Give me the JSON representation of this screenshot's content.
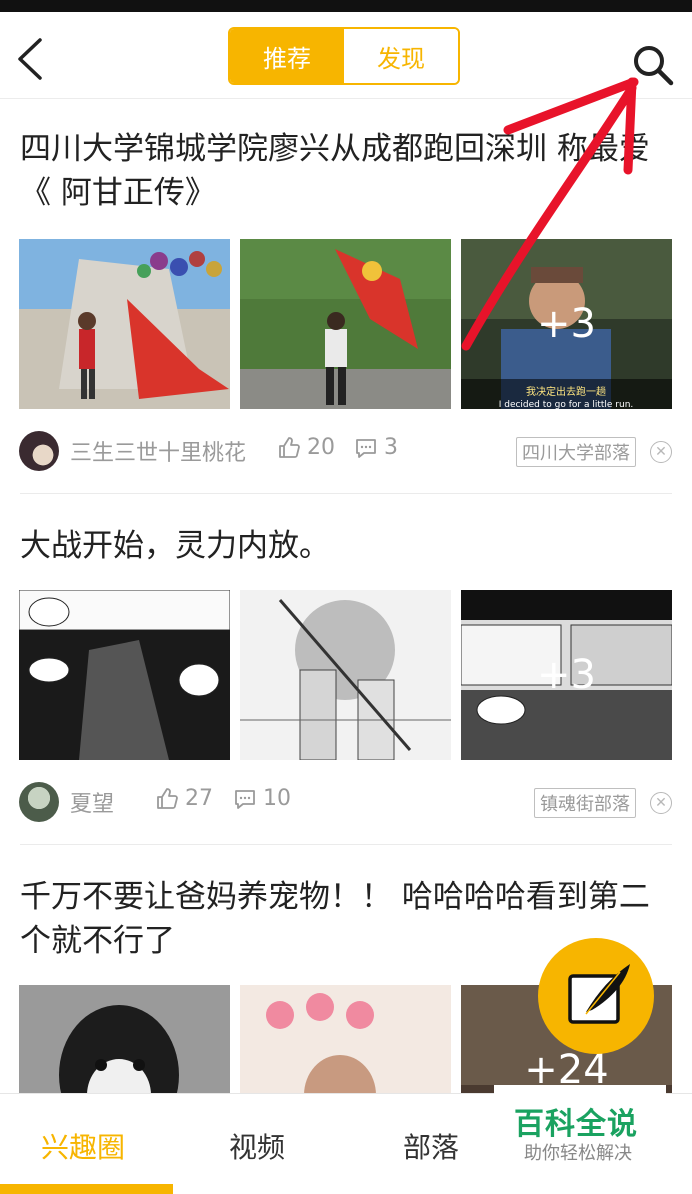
{
  "header": {
    "tabs": [
      {
        "label": "推荐",
        "active": true
      },
      {
        "label": "发现",
        "active": false
      }
    ]
  },
  "posts": [
    {
      "title": "四川大学锦城学院廖兴从成都跑回深圳 称最爱《 阿甘正传》",
      "more_count": "+3",
      "user": "三生三世十里桃花",
      "likes": "20",
      "comments": "3",
      "tribe": "四川大学部落",
      "image_caption_cn": "我决定出去跑一趟",
      "image_caption_en": "I decided to go for a little run."
    },
    {
      "title": "大战开始，灵力内放。",
      "more_count": "+3",
      "user": "夏望",
      "likes": "27",
      "comments": "10",
      "tribe": "镇魂街部落"
    },
    {
      "title": "千万不要让爸妈养宠物！！ 哈哈哈哈看到第二个就不行了",
      "more_count": "+24"
    }
  ],
  "tabbar": {
    "items": [
      {
        "label": "兴趣圈",
        "active": true
      },
      {
        "label": "视频",
        "active": false
      },
      {
        "label": "部落",
        "active": false
      }
    ]
  },
  "watermark": {
    "title": "百科全说",
    "subtitle": "助你轻松解决"
  },
  "colors": {
    "accent": "#f7b500",
    "annotation_arrow": "#e8132a"
  }
}
